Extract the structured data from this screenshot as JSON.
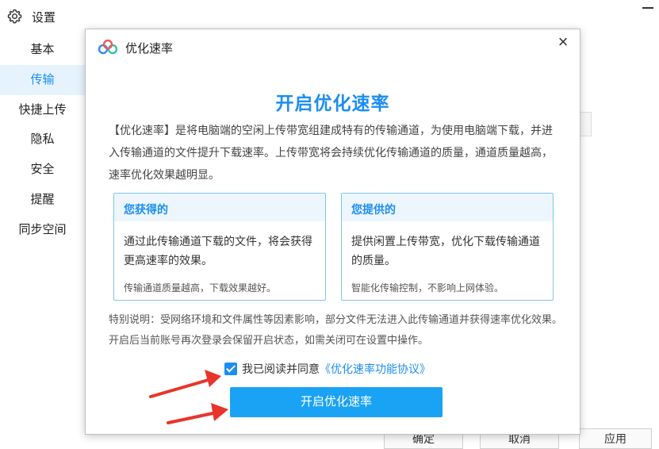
{
  "settings": {
    "title": "设置",
    "nav": [
      {
        "label": "基本"
      },
      {
        "label": "传输",
        "active": true
      },
      {
        "label": "快捷上传"
      },
      {
        "label": "隐私"
      },
      {
        "label": "安全"
      },
      {
        "label": "提醒"
      },
      {
        "label": "同步空间"
      }
    ],
    "footer_buttons": {
      "confirm": "确定",
      "cancel": "取消",
      "apply": "应用"
    }
  },
  "dialog": {
    "title": "优化速率",
    "close_icon": "close-icon",
    "headline": "开启优化速率",
    "intro": "【优化速率】是将电脑端的空闲上传带宽组建成特有的传输通道，为使用电脑端下载，并进入传输通道的文件提升下载速率。上传带宽将会持续优化传输通道的质量，通道质量越高，速率优化效果越明显。",
    "cards": [
      {
        "heading": "您获得的",
        "body": "通过此传输通道下载的文件，将会获得更高速率的效果。",
        "note": "传输通道质量越高，下载效果越好。"
      },
      {
        "heading": "您提供的",
        "body": "提供闲置上传带宽，优化下载传输通道的质量。",
        "note": "智能化传输控制，不影响上网体验。"
      }
    ],
    "notice": "特别说明：受网络环境和文件属性等因素影响，部分文件无法进入此传输通道并获得速率优化效果。开启后当前账号再次登录会保留开启状态，如需关闭可在设置中操作。",
    "agreement": {
      "checked": true,
      "text": "我已阅读并同意",
      "link": "《优化速率功能协议》"
    },
    "primary_button": "开启优化速率"
  },
  "colors": {
    "accent": "#1c8ef2",
    "button": "#1aa3f5",
    "annotation_arrow": "#e8342a"
  }
}
